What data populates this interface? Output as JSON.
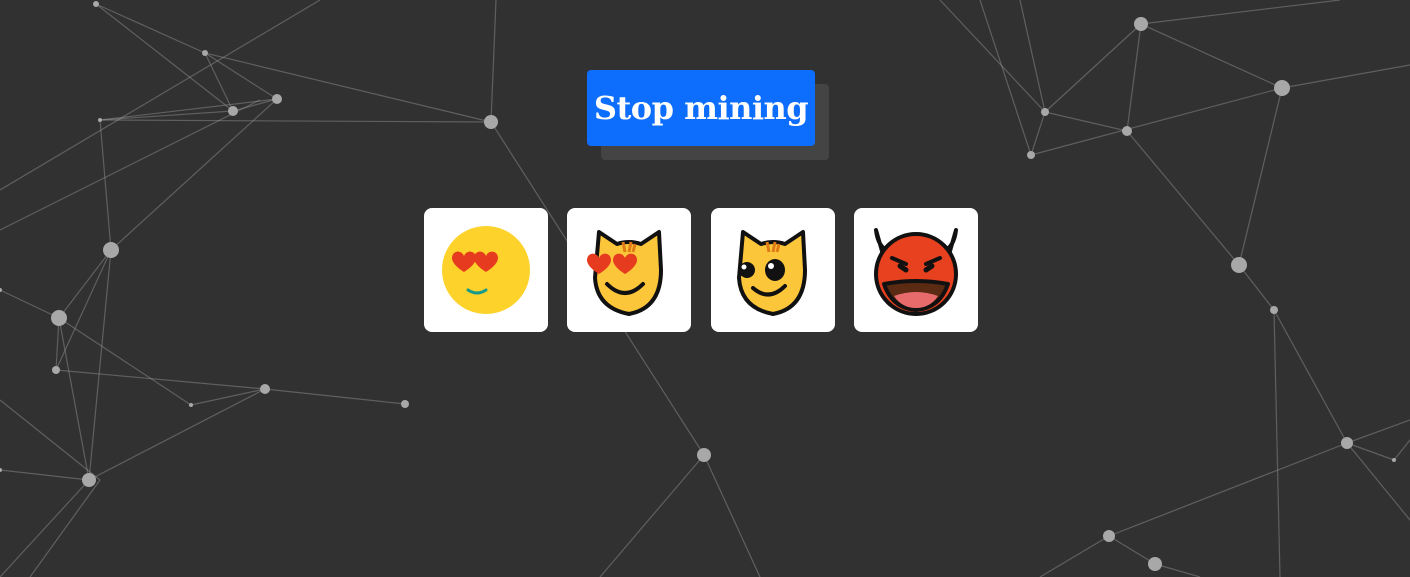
{
  "controls": {
    "stop_button_label": "Stop mining"
  },
  "colors": {
    "background": "#313131",
    "button_blue": "#0d6efd",
    "network_line": "#9a9a9a",
    "emoji_yellow": "#fcd22b",
    "emoji_heart_red": "#e63b1e",
    "devil_red": "#e8411f"
  },
  "emoji_tiles": [
    {
      "icon": "smiling-face-with-heart-eyes-icon"
    },
    {
      "icon": "smiling-cat-with-heart-eyes-icon"
    },
    {
      "icon": "cat-with-wry-smile-icon"
    },
    {
      "icon": "smiling-face-with-horns-icon"
    }
  ]
}
